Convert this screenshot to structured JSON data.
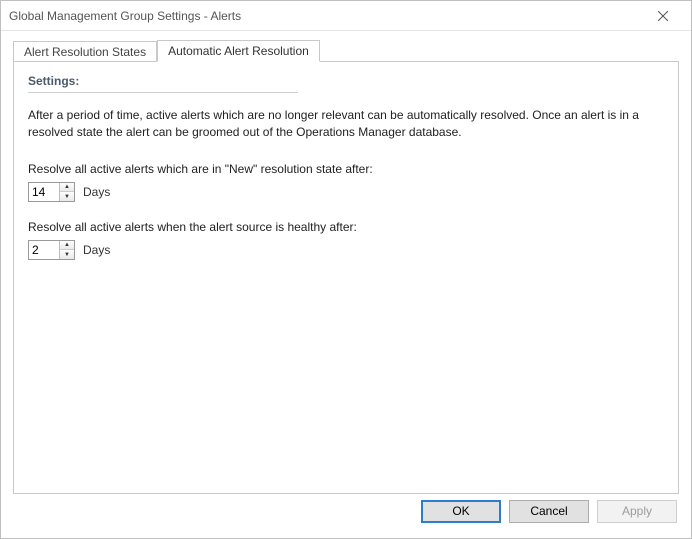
{
  "window": {
    "title": "Global Management Group Settings - Alerts"
  },
  "tabs": {
    "resolution_states": "Alert Resolution States",
    "auto_resolution": "Automatic Alert Resolution"
  },
  "panel": {
    "heading": "Settings:",
    "description": "After a period of time, active alerts which are no longer relevant can be automatically resolved. Once an alert is in a resolved state the alert can be groomed out of the Operations Manager database.",
    "new_state": {
      "label": "Resolve all active alerts which are in \"New\" resolution state after:",
      "value": "14",
      "unit": "Days"
    },
    "healthy_source": {
      "label": "Resolve all active alerts when the alert source is healthy after:",
      "value": "2",
      "unit": "Days"
    }
  },
  "buttons": {
    "ok": "OK",
    "cancel": "Cancel",
    "apply": "Apply"
  }
}
